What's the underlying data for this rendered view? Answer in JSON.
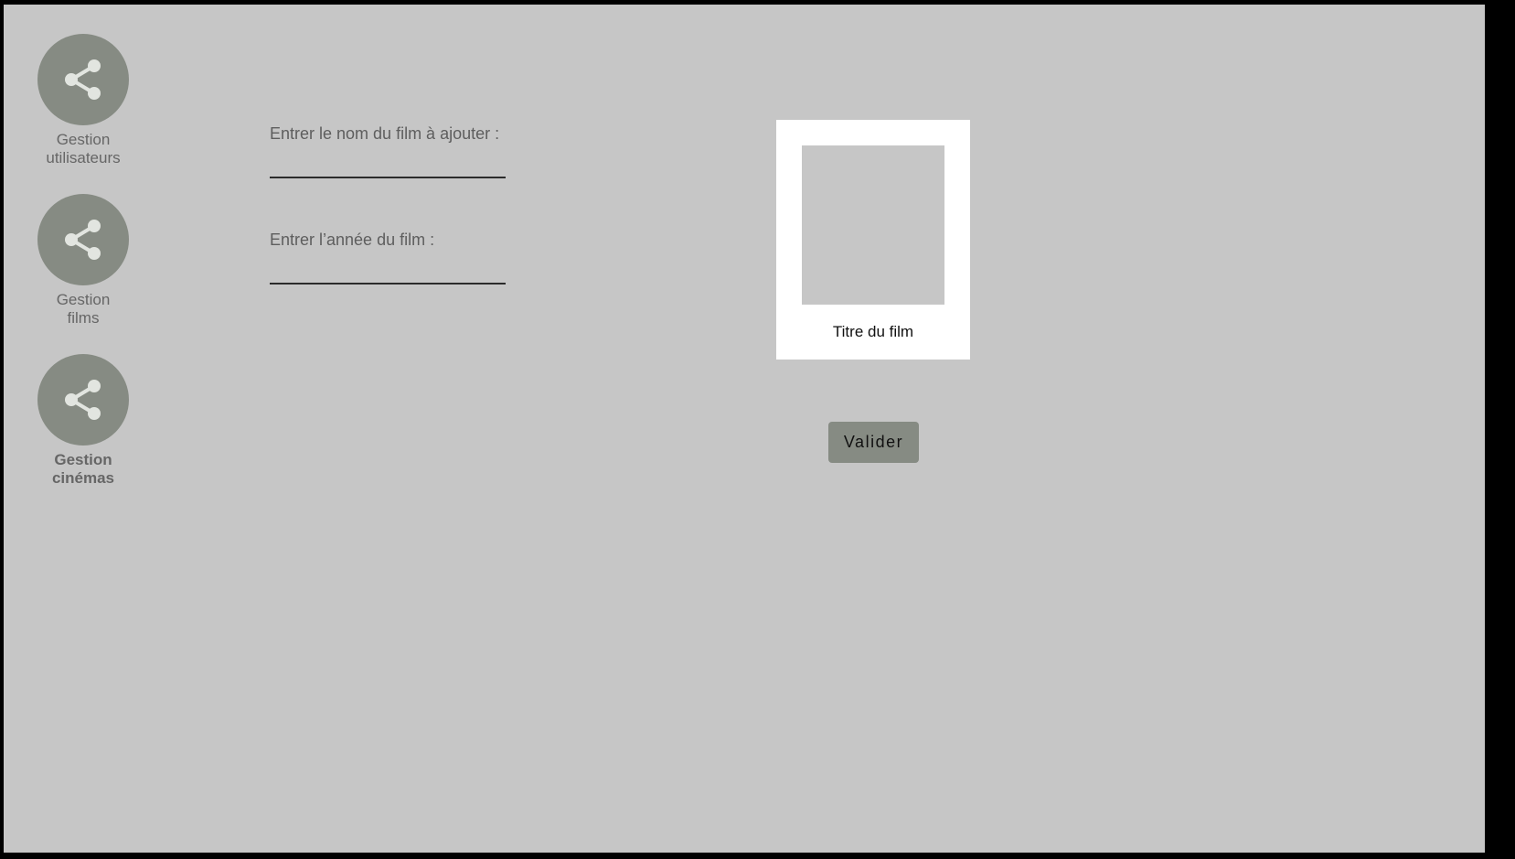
{
  "sidebar": {
    "items": [
      {
        "label": "Gestion\nutilisateurs",
        "icon": "share-icon",
        "active": false
      },
      {
        "label": "Gestion\nfilms",
        "icon": "share-icon",
        "active": false
      },
      {
        "label": "Gestion\ncinémas",
        "icon": "share-icon",
        "active": true
      }
    ]
  },
  "form": {
    "film_name": {
      "label": "Entrer le nom du film à ajouter :",
      "value": ""
    },
    "film_year": {
      "label": "Entrer l’année du film :",
      "value": ""
    }
  },
  "poster": {
    "title": "Titre du film"
  },
  "actions": {
    "submit_label": "Valider"
  },
  "colors": {
    "background": "#c6c6c6",
    "nav_circle": "#868b83",
    "button": "#868b83",
    "icon": "#e2e5e0",
    "card": "#ffffff"
  }
}
